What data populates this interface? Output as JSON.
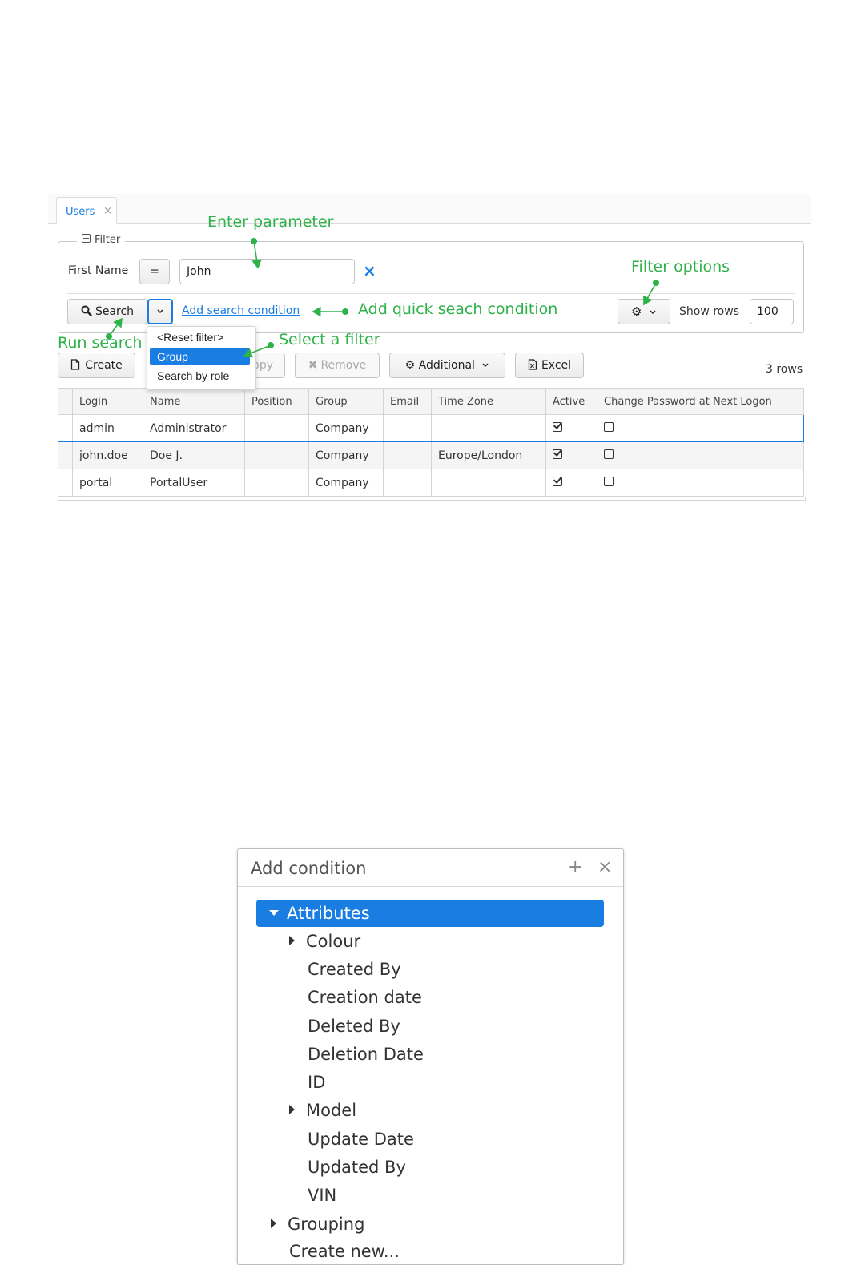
{
  "tab": {
    "label": "Users",
    "close": "×"
  },
  "filter": {
    "legend": "Filter",
    "field_label": "First Name",
    "operator": "=",
    "value": "John",
    "clear_icon": "×",
    "search_label": "Search",
    "add_condition_link": "Add search condition",
    "show_rows_label": "Show rows",
    "show_rows_value": "100"
  },
  "filter_menu": {
    "items": [
      "<Reset filter>",
      "Group",
      "Search by role"
    ],
    "selected": "Group"
  },
  "toolbar": {
    "create": "Create",
    "copy_partial": "opy",
    "remove": "Remove",
    "additional": "Additional",
    "excel": "Excel",
    "row_count": "3 rows"
  },
  "table": {
    "columns": [
      "Login",
      "Name",
      "Position",
      "Group",
      "Email",
      "Time Zone",
      "Active",
      "Change Password at Next Logon"
    ],
    "rows": [
      {
        "login": "admin",
        "name": "Administrator",
        "position": "",
        "group": "Company",
        "email": "",
        "timezone": "",
        "active": true,
        "change_pw": false
      },
      {
        "login": "john.doe",
        "name": "Doe J.",
        "position": "",
        "group": "Company",
        "email": "",
        "timezone": "Europe/London",
        "active": true,
        "change_pw": false
      },
      {
        "login": "portal",
        "name": "PortalUser",
        "position": "",
        "group": "Company",
        "email": "",
        "timezone": "",
        "active": true,
        "change_pw": false
      }
    ]
  },
  "annotations": {
    "enter_parameter": "Enter parameter",
    "filter_options": "Filter options",
    "add_quick": "Add quick seach condition",
    "run_search": "Run search",
    "select_filter": "Select a filter",
    "color": "#2eb24a"
  },
  "dialog": {
    "title": "Add condition",
    "add_btn": "+",
    "close_btn": "×",
    "tree": {
      "root": "Attributes",
      "children": [
        "Colour",
        "Created By",
        "Creation date",
        "Deleted By",
        "Deletion Date",
        "ID",
        "Model",
        "Update Date",
        "Updated By",
        "VIN"
      ],
      "expandable_children": [
        "Colour",
        "Model"
      ],
      "grouping": "Grouping",
      "create_new": "Create new..."
    }
  },
  "colors": {
    "accent": "#197de1",
    "annotation": "#2eb24a"
  }
}
